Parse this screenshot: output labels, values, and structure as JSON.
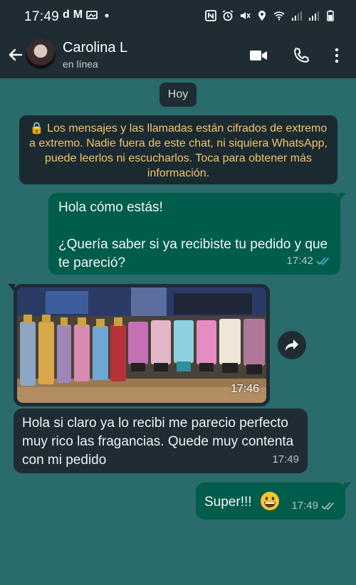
{
  "status_bar": {
    "time": "17:49",
    "left_icons": [
      "d",
      "M"
    ]
  },
  "header": {
    "contact_name": "Carolina L",
    "contact_status": "en línea"
  },
  "date_pill": "Hoy",
  "encryption_notice": "🔒 Los mensajes y las llamadas están cifrados de extremo a extremo. Nadie fuera de este chat, ni siquiera WhatsApp, puede leerlos ni escucharlos. Toca para obtener más información.",
  "messages": [
    {
      "direction": "outgoing",
      "lines": [
        "Hola cómo estás!",
        "",
        "¿Quería saber si ya recibiste tu pedido y que te pareció?"
      ],
      "time": "17:42",
      "status": "read"
    },
    {
      "direction": "incoming",
      "type": "image",
      "time": "17:46"
    },
    {
      "direction": "incoming",
      "text": "Hola si claro ya lo recibi me parecio perfecto muy rico las fragancias. Quede muy contenta con mi pedido",
      "time": "17:49"
    },
    {
      "direction": "outgoing",
      "text": "Super!!!",
      "emoji": "grinning-face",
      "time": "17:49",
      "status": "delivered"
    }
  ],
  "colors": {
    "chat_background": "#2a6b6c",
    "header": "#1f2c34",
    "outgoing_bubble": "#005c4b",
    "incoming_bubble": "#1f2c34",
    "notice_text": "#f3c46b",
    "read_ticks": "#53bdeb"
  }
}
